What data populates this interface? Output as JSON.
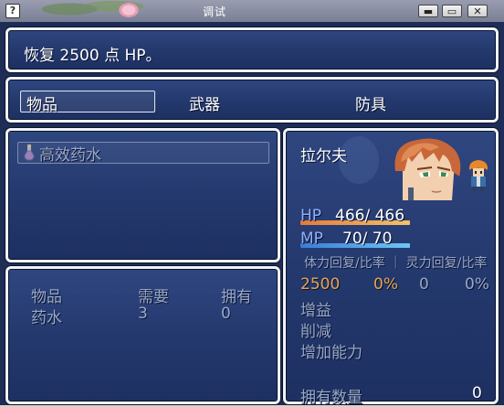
{
  "window": {
    "icon_glyph": "?",
    "title": "调试",
    "minimize": "▬",
    "maximize": "▭",
    "close": "✕"
  },
  "help": {
    "text": "恢复 2500 点 HP。"
  },
  "categories": {
    "items": "物品",
    "weapons": "武器",
    "armor": "防具",
    "selected": "物品"
  },
  "item_list": [
    {
      "name": "高效药水",
      "icon": "potion-icon",
      "enabled": false
    }
  ],
  "materials": {
    "headers": {
      "item": "物品",
      "required": "需要",
      "owned": "拥有"
    },
    "rows": [
      {
        "item": "药水",
        "required": "3",
        "owned": "0"
      }
    ]
  },
  "status": {
    "name": "拉尔夫",
    "hp_label": "HP",
    "hp_value": "466/ 466",
    "hp_fraction": 1.0,
    "mp_label": "MP",
    "mp_value": "70/ 70",
    "mp_fraction": 1.0,
    "regen_header": "体力回复/比率 ｜ 灵力回复/比率",
    "hp_regen": "2500",
    "hp_regen_rate": "0%",
    "mp_regen": "0",
    "mp_regen_rate": "0%",
    "buffs_label": "增益",
    "debuffs_label": "削减",
    "params_label": "增加能力",
    "owned_label": "拥有数量",
    "owned_value": "0"
  },
  "colors": {
    "window_bg": "#23386c",
    "window_border": "#f0f2f6",
    "highlight_orange": "#e8a450",
    "dim_text": "#98a8c8"
  }
}
